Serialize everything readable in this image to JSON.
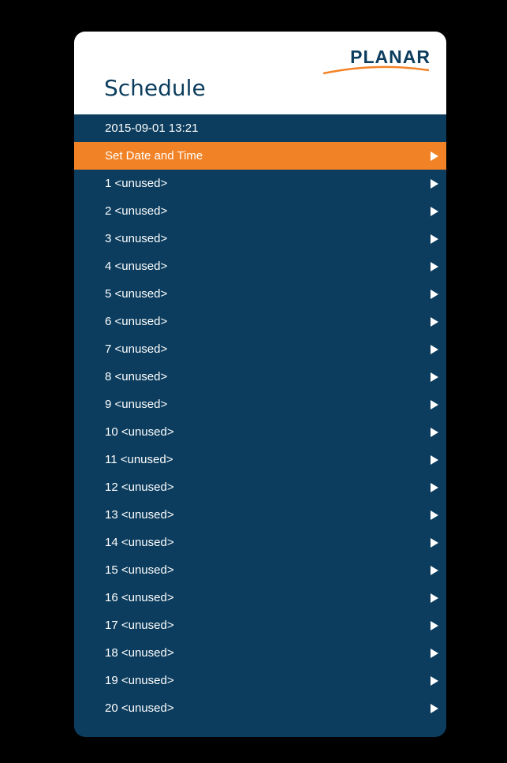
{
  "brand": {
    "name": "PLANAR",
    "accent_color": "#f28226",
    "primary_color": "#0c3d5e"
  },
  "header": {
    "title": "Schedule"
  },
  "datetime": "2015-09-01 13:21",
  "menu": {
    "set_date_time": {
      "label": "Set Date and Time",
      "arrow_icon": "chevron-right-icon"
    },
    "schedules": [
      {
        "label": "1 <unused>"
      },
      {
        "label": "2 <unused>"
      },
      {
        "label": "3 <unused>"
      },
      {
        "label": "4 <unused>"
      },
      {
        "label": "5 <unused>"
      },
      {
        "label": "6 <unused>"
      },
      {
        "label": "7 <unused>"
      },
      {
        "label": "8 <unused>"
      },
      {
        "label": "9 <unused>"
      },
      {
        "label": "10 <unused>"
      },
      {
        "label": "11 <unused>"
      },
      {
        "label": "12 <unused>"
      },
      {
        "label": "13 <unused>"
      },
      {
        "label": "14 <unused>"
      },
      {
        "label": "15 <unused>"
      },
      {
        "label": "16 <unused>"
      },
      {
        "label": "17 <unused>"
      },
      {
        "label": "18 <unused>"
      },
      {
        "label": "19 <unused>"
      },
      {
        "label": "20 <unused>"
      }
    ]
  }
}
